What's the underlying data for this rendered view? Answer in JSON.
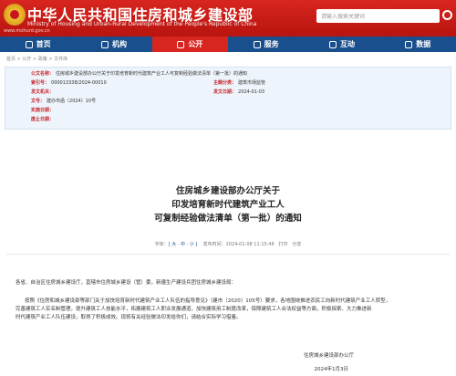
{
  "header": {
    "site_title_cn": "中华人民共和国住房和城乡建设部",
    "site_title_en": "Ministry of Housing and Urban-Rural Development of the People's Republic of China",
    "site_url": "www.mohurd.gov.cn",
    "search_placeholder": "请输入搜索关键词"
  },
  "nav": {
    "items": [
      {
        "label": "首页"
      },
      {
        "label": "机构"
      },
      {
        "label": "公开",
        "active": true
      },
      {
        "label": "服务"
      },
      {
        "label": "互动"
      },
      {
        "label": "数据"
      }
    ]
  },
  "breadcrumb": "首页 > 公开 > 政策 > 文件库",
  "info": {
    "index_label": "索引号：",
    "index_value": "000013338/2024-00010",
    "issuer_label": "主题分类：",
    "issuer_value": "建筑市场监管",
    "pubdate_label": "发文日期：",
    "pubdate_value": "2024-01-03",
    "title_label": "公文名称：",
    "title_value": "住房城乡建设部办公厅关于印发培育新时代建筑产业工人可复制经验做法清单（第一批）的通知",
    "org_label": "发文机关：",
    "org_value": "",
    "doc_no_label": "文号：",
    "doc_no_value": "建办市函〔2024〕10号",
    "effective_label": "实施日期：",
    "effective_value": "",
    "expiry_label": "废止日期：",
    "expiry_value": ""
  },
  "article": {
    "title_line1": "住房城乡建设部办公厅关于",
    "title_line2": "印发培育新时代建筑产业工人",
    "title_line3": "可复制经验做法清单（第一批）的通知",
    "font_size_label": "字体：",
    "font_sizes": "[ 大 · 中 · 小 ]",
    "publish_time_label": "发布时间：",
    "publish_time": "2024-01-08 11:15:46",
    "print_label": "打印",
    "share_label": "分享",
    "recipients": "各省、自治区住房城乡建设厅，直辖市住房城乡建设（管）委，新疆生产建设兵团住房城乡建设局：",
    "body_line1": "按照《住房和城乡建设部等部门关于加快培育新时代建筑产业工人队伍的指导意见》（建市〔2020〕105号）要求，各地围绕推进农民工向新时代建筑产业工人转型，",
    "body_line2": "完善建筑工人实名制管理，提升建筑工人技能水平，拓展建筑工人职业发展通道，加快建筑用工制度改革，保障建筑工人合法权益等方面，积极探索、大力推进新",
    "body_line3": "时代建筑产业工人队伍建设，取得了积极成效。现将有关经验做法印发给你们，请结合实际学习借鉴。",
    "signature_org": "住房城乡建设部办公厅",
    "signature_date": "2024年1月3日"
  }
}
